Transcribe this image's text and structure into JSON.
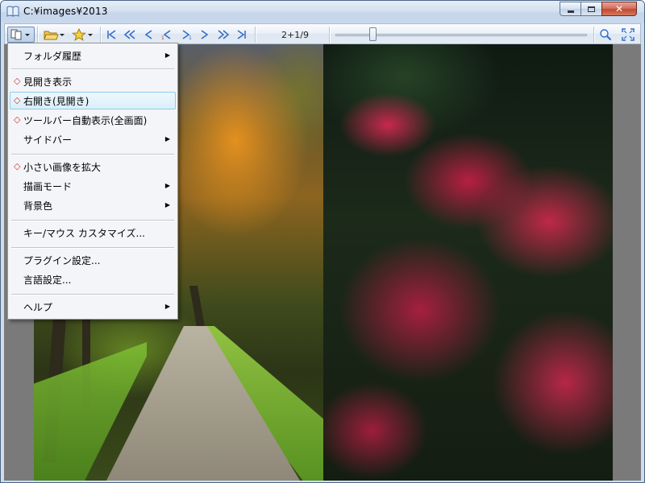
{
  "window": {
    "title": "C:¥images¥2013",
    "controls": {
      "minimize": "minimize",
      "maximize": "maximize",
      "close": "✕"
    }
  },
  "toolbar": {
    "page_indicator": "2+1/9",
    "slider_position_fraction": 0.135,
    "icons": [
      "view-menu-icon",
      "open-folder-icon",
      "bookmark-star-icon",
      "first-page-icon",
      "fast-back-icon",
      "prev-page-icon",
      "prev-single-page-icon",
      "next-single-page-icon",
      "next-page-icon",
      "fast-forward-icon",
      "last-page-icon",
      "zoom-icon",
      "fullscreen-icon"
    ]
  },
  "menu": {
    "items": [
      {
        "label": "フォルダ履歴",
        "checked": false,
        "submenu": true
      },
      {
        "label": "見開き表示",
        "checked": true,
        "submenu": false
      },
      {
        "label": "右開き(見開き)",
        "checked": true,
        "submenu": false,
        "highlighted": true
      },
      {
        "label": "ツールバー自動表示(全画面)",
        "checked": true,
        "submenu": false
      },
      {
        "label": "サイドバー",
        "checked": false,
        "submenu": true
      },
      {
        "label": "小さい画像を拡大",
        "checked": true,
        "submenu": false
      },
      {
        "label": "描画モード",
        "checked": false,
        "submenu": true
      },
      {
        "label": "背景色",
        "checked": false,
        "submenu": true
      },
      {
        "label": "キー/マウス カスタマイズ...",
        "checked": false,
        "submenu": false
      },
      {
        "label": "プラグイン設定...",
        "checked": false,
        "submenu": false
      },
      {
        "label": "言語設定...",
        "checked": false,
        "submenu": false
      },
      {
        "label": "ヘルプ",
        "checked": false,
        "submenu": true
      }
    ],
    "check_glyph": "◇",
    "submenu_glyph": "▶"
  },
  "colors": {
    "accent": "#2f6cc7",
    "check": "#d03a2a",
    "highlight_border": "#8fcce9"
  }
}
